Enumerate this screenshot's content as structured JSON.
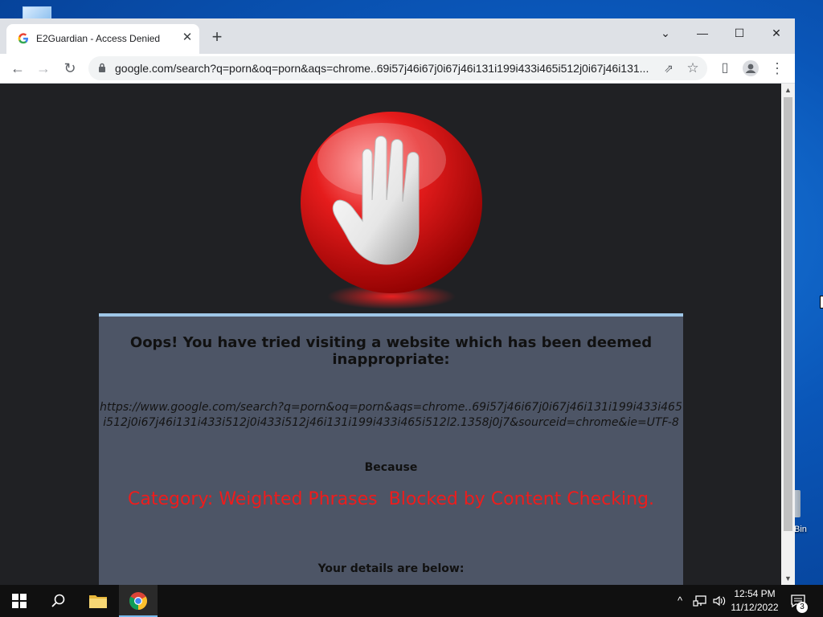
{
  "browser": {
    "tab": {
      "title": "E2Guardian - Access Denied",
      "favicon": "google-g-icon",
      "close_glyph": "✕"
    },
    "new_tab_glyph": "+",
    "window_controls": {
      "tab_search": "⌄",
      "minimize": "—",
      "maximize": "☐",
      "close": "✕"
    },
    "nav": {
      "back": "←",
      "forward": "→",
      "reload": "↻"
    },
    "address_bar": {
      "url": "google.com/search?q=porn&oq=porn&aqs=chrome..69i57j46i67j0i67j46i131i199i433i465i512j0i67j46i131..."
    },
    "toolbar_icons": {
      "share": "⇗",
      "bookmark": "☆",
      "side_panel": "▯",
      "profile": "profile-icon",
      "menu": "⋮"
    }
  },
  "page": {
    "heading": "Oops! You have tried visiting a website which has been deemed inappropriate:",
    "blocked_url": "https://www.google.com/search?q=porn&oq=porn&aqs=chrome..69i57j46i67j0i67j46i131i199i433i465i512j0i67j46i131i433i512j0i433i512j46i131i199i433i465i512l2.1358j0j7&sourceid=chrome&ie=UTF-8",
    "because_label": "Because",
    "category": "Category: Weighted Phrases  Blocked by Content Checking.",
    "details_label": "Your details are below:"
  },
  "desktop": {
    "recycle_bin_label": "Bin"
  },
  "taskbar": {
    "pinned": [
      "start-icon",
      "search-icon",
      "file-explorer-icon",
      "chrome-icon"
    ],
    "tray": {
      "chevron": "^"
    },
    "clock": {
      "time": "12:54 PM",
      "date": "11/12/2022"
    },
    "notifications": {
      "count": "3"
    }
  },
  "colors": {
    "page_background": "#202124",
    "panel_background": "#4d5566",
    "panel_border": "#9fc7e8",
    "category_text": "#ee1c1c",
    "stop_red": "#e51c1c"
  }
}
